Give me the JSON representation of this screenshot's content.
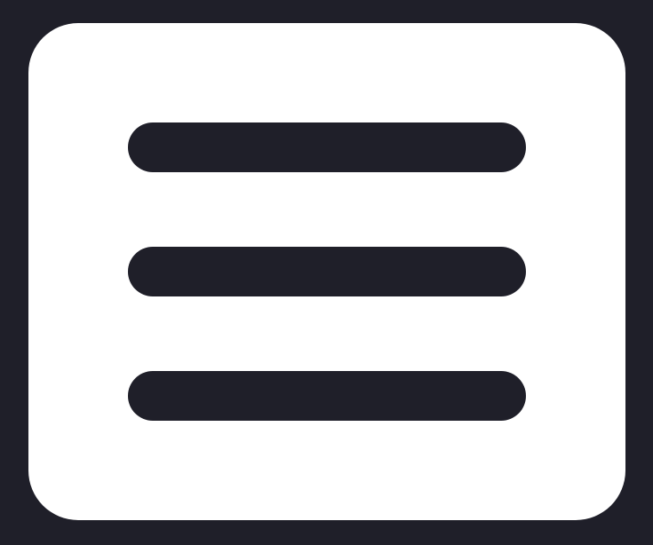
{
  "icon": {
    "name": "hamburger-menu-icon",
    "bar_count": 3
  },
  "colors": {
    "background": "#1f1f29",
    "button_fill": "#ffffff",
    "bar_fill": "#1f1f29"
  }
}
